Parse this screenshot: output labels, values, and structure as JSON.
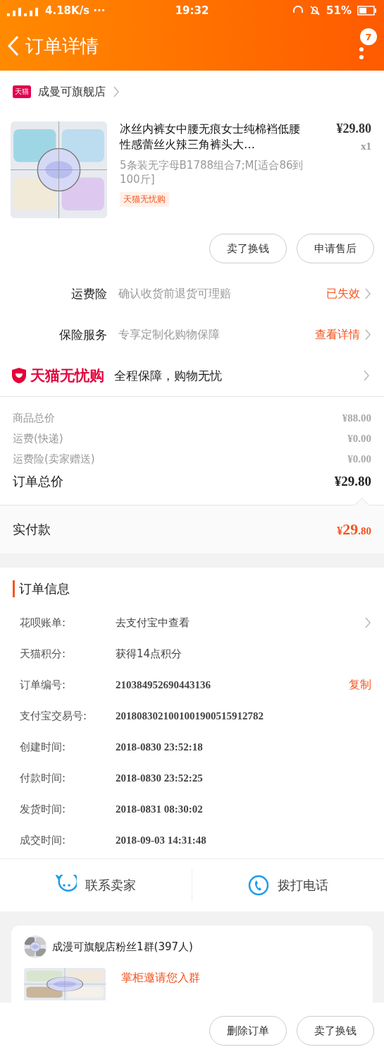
{
  "status_bar": {
    "network": "4.18K/s ···",
    "time": "19:32",
    "battery": "51%"
  },
  "header": {
    "title": "订单详情",
    "badge": "7"
  },
  "store": {
    "logo": "天猫",
    "name": "成曼可旗舰店"
  },
  "product": {
    "kind": "picture",
    "title": "冰丝内裤女中腰无痕女士纯棉裆低腰性感蕾丝火辣三角裤头大…",
    "sku": "5条装无字母B1788组合7;M[适合86到100斤]",
    "tag": "天猫无忧购",
    "price": "¥29.80",
    "qty": "x1"
  },
  "item_actions": [
    "卖了换钱",
    "申请售后"
  ],
  "services": [
    {
      "label": "运费险",
      "desc": "确认收货前退货可理赔",
      "action": "已失效"
    },
    {
      "label": "保险服务",
      "desc": "专享定制化购物保障",
      "action": "查看详情"
    }
  ],
  "guarantee": {
    "brand": "天猫无忧购",
    "text": "全程保障，购物无忧"
  },
  "costs": [
    {
      "label": "商品总价",
      "value": "¥88.00"
    },
    {
      "label": "运费(快递)",
      "value": "¥0.00"
    },
    {
      "label": "运费险(卖家赠送)",
      "value": "¥0.00"
    }
  ],
  "order_total": {
    "label": "订单总价",
    "value": "¥29.80"
  },
  "paid": {
    "label": "实付款",
    "currency": "¥",
    "integer": "29",
    "decimal": ".80"
  },
  "order_info": {
    "title": "订单信息",
    "rows": [
      {
        "label": "花呗账单:",
        "value": "去支付宝中查看",
        "kind": "link"
      },
      {
        "label": "天猫积分:",
        "value": "获得14点积分",
        "kind": "text"
      },
      {
        "label": "订单编号:",
        "value": "210384952690443136",
        "kind": "copy",
        "action": "复制"
      },
      {
        "label": "支付宝交易号:",
        "value": "2018083021001001900515912782",
        "kind": "text"
      },
      {
        "label": "创建时间:",
        "value": "2018-0830 23:52:18",
        "kind": "text"
      },
      {
        "label": "付款时间:",
        "value": "2018-0830 23:52:25",
        "kind": "text"
      },
      {
        "label": "发货时间:",
        "value": "2018-0831 08:30:02",
        "kind": "text"
      },
      {
        "label": "成交时间:",
        "value": "2018-09-03 14:31:48",
        "kind": "text"
      }
    ]
  },
  "contact": [
    {
      "label": "联系卖家",
      "kind": "chat"
    },
    {
      "label": "拨打电话",
      "kind": "phone"
    }
  ],
  "group": {
    "name": "成漫可旗舰店粉丝1群(397人)",
    "invite": "掌柜邀请您入群"
  },
  "bottom_actions": [
    "删除订单",
    "卖了换钱"
  ]
}
